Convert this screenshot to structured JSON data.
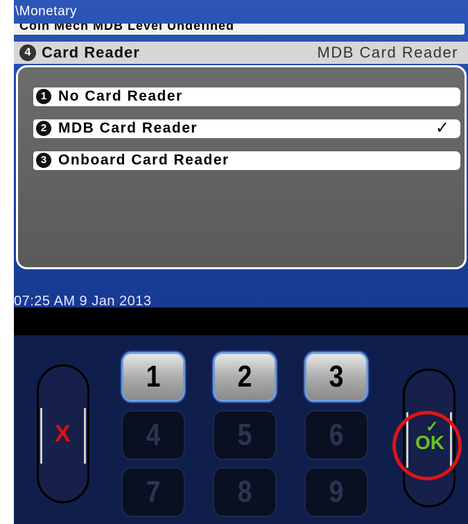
{
  "screen": {
    "breadcrumb": "\\Monetary",
    "previous_row": "Coin Mech MDB Level Undefined",
    "selected_row": {
      "number": "4",
      "label": "Card Reader",
      "value": "MDB Card Reader"
    },
    "options": [
      {
        "number": "1",
        "label": "No Card Reader",
        "checked": ""
      },
      {
        "number": "2",
        "label": "MDB Card Reader",
        "checked": "✓"
      },
      {
        "number": "3",
        "label": "Onboard Card Reader",
        "checked": ""
      }
    ],
    "clock": "07:25 AM 9 Jan 2013"
  },
  "keypad": {
    "keys": [
      "1",
      "2",
      "3",
      "4",
      "5",
      "6",
      "7",
      "8",
      "9"
    ],
    "cancel_symbol": "X",
    "ok_label": "OK",
    "ok_tick": "✓"
  },
  "colors": {
    "screen_blue": "#1f43a6",
    "keypad_navy": "#101e4c",
    "cancel_red": "#e01010",
    "ok_green": "#6cc024",
    "highlight_red": "#e01414"
  }
}
